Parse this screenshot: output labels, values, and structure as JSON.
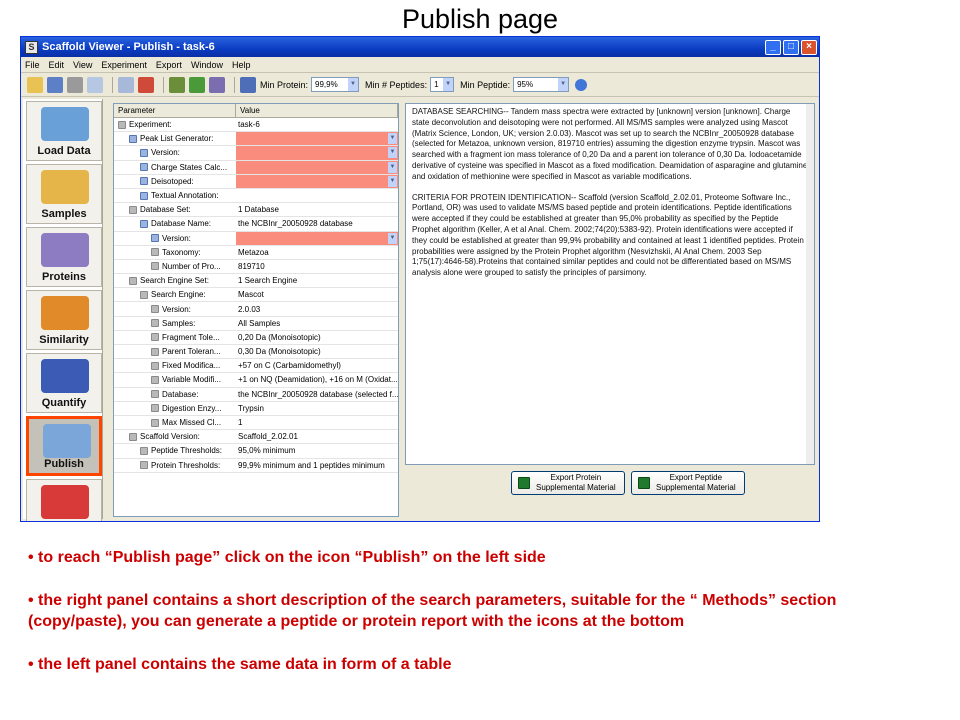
{
  "slide": {
    "title": "Publish page"
  },
  "window": {
    "title": "Scaffold Viewer - Publish - task-6",
    "menu": [
      "File",
      "Edit",
      "View",
      "Experiment",
      "Export",
      "Window",
      "Help"
    ]
  },
  "toolbar": {
    "min_protein_label": "Min Protein:",
    "min_protein_value": "99,9%",
    "min_peptides_label": "Min # Peptides:",
    "min_peptides_value": "1",
    "min_peptide_label": "Min Peptide:",
    "min_peptide_value": "95%"
  },
  "nav": {
    "items": [
      {
        "label": "Load Data",
        "icon": "load-data-icon",
        "color": "#6aa0d8"
      },
      {
        "label": "Samples",
        "icon": "samples-icon",
        "color": "#e5b54a"
      },
      {
        "label": "Proteins",
        "icon": "proteins-icon",
        "color": "#8e7cc3"
      },
      {
        "label": "Similarity",
        "icon": "similarity-icon",
        "color": "#e08a2a"
      },
      {
        "label": "Quantify",
        "icon": "quantify-icon",
        "color": "#3b5bb5"
      },
      {
        "label": "Publish",
        "icon": "publish-icon",
        "color": "#7aa6d9"
      },
      {
        "label": "",
        "icon": "statistics-icon",
        "color": "#d83a3a"
      }
    ]
  },
  "table": {
    "headers": [
      "Parameter",
      "Value"
    ],
    "rows": [
      {
        "indent": 0,
        "param": "Experiment:",
        "value": "task-6",
        "missing": false,
        "icon": "lock"
      },
      {
        "indent": 1,
        "param": "Peak List Generator:",
        "value": "",
        "missing": true,
        "icon": "edit"
      },
      {
        "indent": 2,
        "param": "Version:",
        "value": "",
        "missing": true,
        "icon": "edit"
      },
      {
        "indent": 2,
        "param": "Charge States Calc...",
        "value": "",
        "missing": true,
        "icon": "edit"
      },
      {
        "indent": 2,
        "param": "Deisotoped:",
        "value": "",
        "missing": true,
        "icon": "edit"
      },
      {
        "indent": 2,
        "param": "Textual Annotation:",
        "value": "",
        "missing": false,
        "icon": "edit"
      },
      {
        "indent": 1,
        "param": "Database Set:",
        "value": "1 Database",
        "missing": false,
        "icon": "lock"
      },
      {
        "indent": 2,
        "param": "Database Name:",
        "value": "the NCBInr_20050928 database",
        "missing": false,
        "icon": "edit"
      },
      {
        "indent": 3,
        "param": "Version:",
        "value": "",
        "missing": true,
        "icon": "edit"
      },
      {
        "indent": 3,
        "param": "Taxonomy:",
        "value": "Metazoa",
        "missing": false,
        "icon": "lock"
      },
      {
        "indent": 3,
        "param": "Number of Pro...",
        "value": "819710",
        "missing": false,
        "icon": "lock"
      },
      {
        "indent": 1,
        "param": "Search Engine Set:",
        "value": "1 Search Engine",
        "missing": false,
        "icon": "lock"
      },
      {
        "indent": 2,
        "param": "Search Engine:",
        "value": "Mascot",
        "missing": false,
        "icon": "lock"
      },
      {
        "indent": 3,
        "param": "Version:",
        "value": "2.0.03",
        "missing": false,
        "icon": "lock"
      },
      {
        "indent": 3,
        "param": "Samples:",
        "value": "All Samples",
        "missing": false,
        "icon": "lock"
      },
      {
        "indent": 3,
        "param": "Fragment Tole...",
        "value": "0,20 Da (Monoisotopic)",
        "missing": false,
        "icon": "lock"
      },
      {
        "indent": 3,
        "param": "Parent Toleran...",
        "value": "0,30 Da (Monoisotopic)",
        "missing": false,
        "icon": "lock"
      },
      {
        "indent": 3,
        "param": "Fixed Modifica...",
        "value": "+57 on C (Carbamidomethyl)",
        "missing": false,
        "icon": "lock"
      },
      {
        "indent": 3,
        "param": "Variable Modifi...",
        "value": "+1 on NQ (Deamidation), +16 on M (Oxidat...",
        "missing": false,
        "icon": "lock"
      },
      {
        "indent": 3,
        "param": "Database:",
        "value": "the NCBInr_20050928 database (selected f...",
        "missing": false,
        "icon": "lock"
      },
      {
        "indent": 3,
        "param": "Digestion Enzy...",
        "value": "Trypsin",
        "missing": false,
        "icon": "lock"
      },
      {
        "indent": 3,
        "param": "Max Missed Cl...",
        "value": "1",
        "missing": false,
        "icon": "lock"
      },
      {
        "indent": 1,
        "param": "Scaffold Version:",
        "value": "Scaffold_2.02.01",
        "missing": false,
        "icon": "lock"
      },
      {
        "indent": 2,
        "param": "Peptide Thresholds:",
        "value": "95,0% minimum",
        "missing": false,
        "icon": "lock"
      },
      {
        "indent": 2,
        "param": "Protein Thresholds:",
        "value": "99,9% minimum and 1 peptides minimum",
        "missing": false,
        "icon": "lock"
      }
    ]
  },
  "methods": {
    "paragraphs": [
      "DATABASE SEARCHING-- Tandem mass spectra were extracted by [unknown] version [unknown]. Charge state deconvolution and deisotoping were not performed. All MS/MS samples were analyzed using Mascot (Matrix Science, London, UK; version 2.0.03). Mascot was set up to search the NCBInr_20050928 database (selected for Metazoa, unknown version, 819710 entries) assuming the digestion enzyme trypsin. Mascot was searched with a fragment ion mass tolerance of 0,20 Da and a parent ion tolerance of 0,30 Da. Iodoacetamide derivative of cysteine was specified in Mascot as a fixed modification. Deamidation of asparagine and glutamine and oxidation of methionine were specified in Mascot as variable modifications.",
      "CRITERIA FOR PROTEIN IDENTIFICATION-- Scaffold (version Scaffold_2.02.01, Proteome Software Inc., Portland, OR) was used to validate MS/MS based peptide and protein identifications. Peptide identifications were accepted if they could be established at greater than 95,0% probability as specified by the Peptide Prophet algorithm (Keller, A et al Anal. Chem. 2002;74(20):5383-92). Protein identifications were accepted if they could be established at greater than 99,9% probability and contained at least 1 identified peptides.  Protein probabilities were assigned by the Protein Prophet algorithm (Nesvizhskii, Al Anal Chem. 2003 Sep 1;75(17):4646-58).Proteins that contained similar peptides and could not be differentiated based on MS/MS analysis alone were grouped to satisfy the principles of parsimony."
    ]
  },
  "export": {
    "protein_label": "Export Protein\nSupplemental Material",
    "peptide_label": "Export Peptide\nSupplemental Material"
  },
  "bullets": [
    "• to reach “Publish page” click on the icon “Publish” on the left side",
    "• the right panel contains a short description of the search parameters, suitable for the “ Methods” section (copy/paste), you can generate a peptide or protein report with the icons at the bottom",
    "• the left panel contains the same data in form of a table"
  ]
}
